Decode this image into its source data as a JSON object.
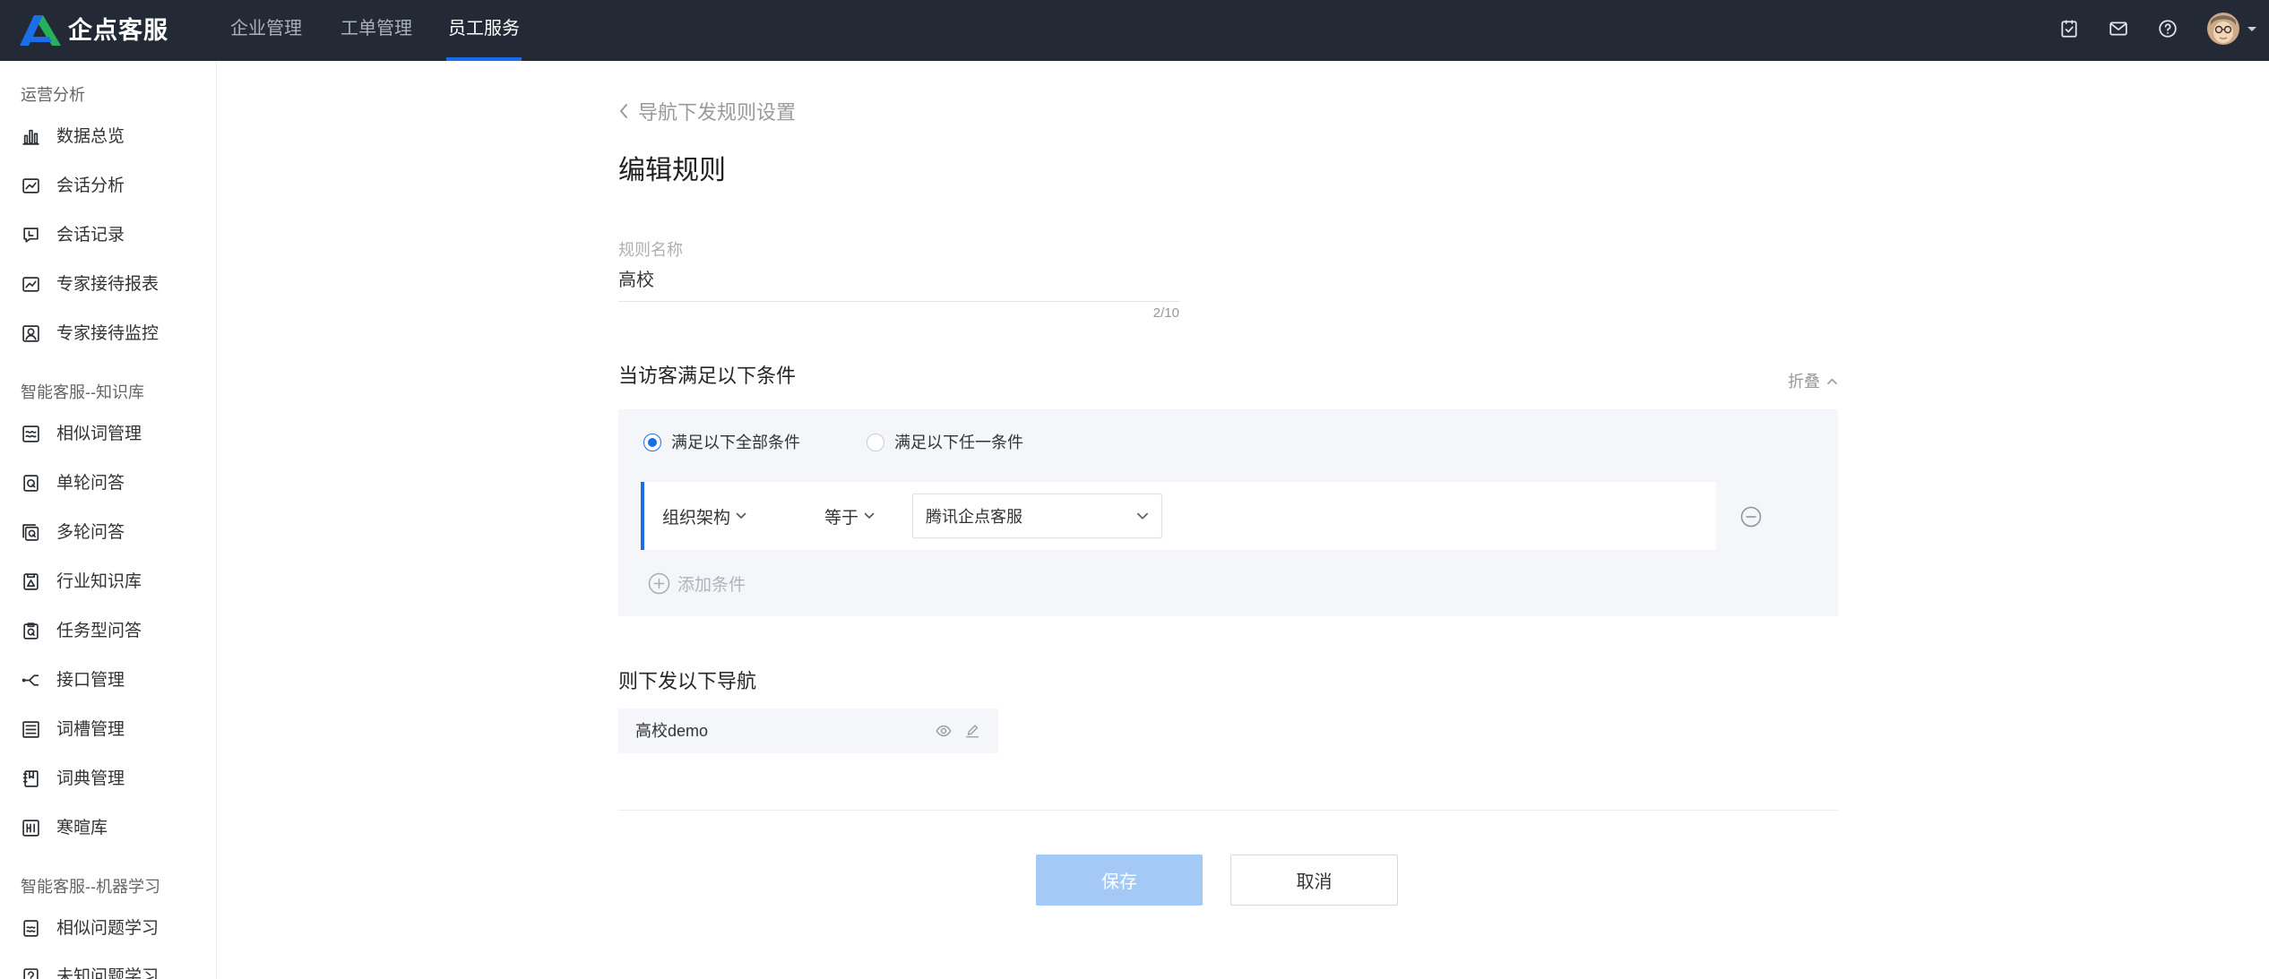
{
  "app": {
    "logo_text": "企点客服"
  },
  "colors": {
    "header-bg": "#232a36",
    "accent": "#1a6fe8",
    "logo-green": "#27b05b",
    "panel-bg": "#f4f6fa",
    "save-disabled-bg": "#a4c9f6"
  },
  "topnav": {
    "items": [
      {
        "label": "企业管理",
        "active": false
      },
      {
        "label": "工单管理",
        "active": false
      },
      {
        "label": "员工服务",
        "active": true
      }
    ]
  },
  "header_actions": {
    "icons": [
      "task-check-icon",
      "mail-icon",
      "help-icon"
    ],
    "avatar": "user-avatar"
  },
  "sidebar": {
    "groups": [
      {
        "label": "运营分析",
        "items": [
          {
            "label": "数据总览",
            "icon": "bar-chart-icon"
          },
          {
            "label": "会话分析",
            "icon": "line-chart-icon"
          },
          {
            "label": "会话记录",
            "icon": "chat-history-icon"
          },
          {
            "label": "专家接待报表",
            "icon": "report-chart-icon"
          },
          {
            "label": "专家接待监控",
            "icon": "monitor-user-icon"
          }
        ]
      },
      {
        "label": "智能客服--知识库",
        "items": [
          {
            "label": "相似词管理",
            "icon": "similar-words-icon"
          },
          {
            "label": "单轮问答",
            "icon": "single-qa-icon"
          },
          {
            "label": "多轮问答",
            "icon": "multi-qa-icon"
          },
          {
            "label": "行业知识库",
            "icon": "industry-kb-icon"
          },
          {
            "label": "任务型问答",
            "icon": "task-qa-icon"
          },
          {
            "label": "接口管理",
            "icon": "api-icon"
          },
          {
            "label": "词槽管理",
            "icon": "slot-icon"
          },
          {
            "label": "词典管理",
            "icon": "dictionary-icon"
          },
          {
            "label": "寒暄库",
            "icon": "greeting-icon"
          }
        ]
      },
      {
        "label": "智能客服--机器学习",
        "items": [
          {
            "label": "相似问题学习",
            "icon": "similar-question-icon"
          },
          {
            "label": "未知问题学习",
            "icon": "unknown-question-icon"
          }
        ]
      }
    ]
  },
  "page": {
    "back_label": "导航下发规则设置",
    "title": "编辑规则",
    "rule_name": {
      "label": "规则名称",
      "value": "高校",
      "counter": "2/10"
    },
    "conditions": {
      "heading": "当访客满足以下条件",
      "collapse_label": "折叠",
      "match_mode": [
        {
          "label": "满足以下全部条件",
          "selected": true
        },
        {
          "label": "满足以下任一条件",
          "selected": false
        }
      ],
      "rows": [
        {
          "field": "组织架构",
          "operator": "等于",
          "value": "腾讯企点客服"
        }
      ],
      "add_label": "添加条件"
    },
    "navigation": {
      "heading": "则下发以下导航",
      "items": [
        {
          "label": "高校demo"
        }
      ]
    },
    "actions": {
      "save_label": "保存",
      "cancel_label": "取消",
      "save_disabled": true
    }
  }
}
